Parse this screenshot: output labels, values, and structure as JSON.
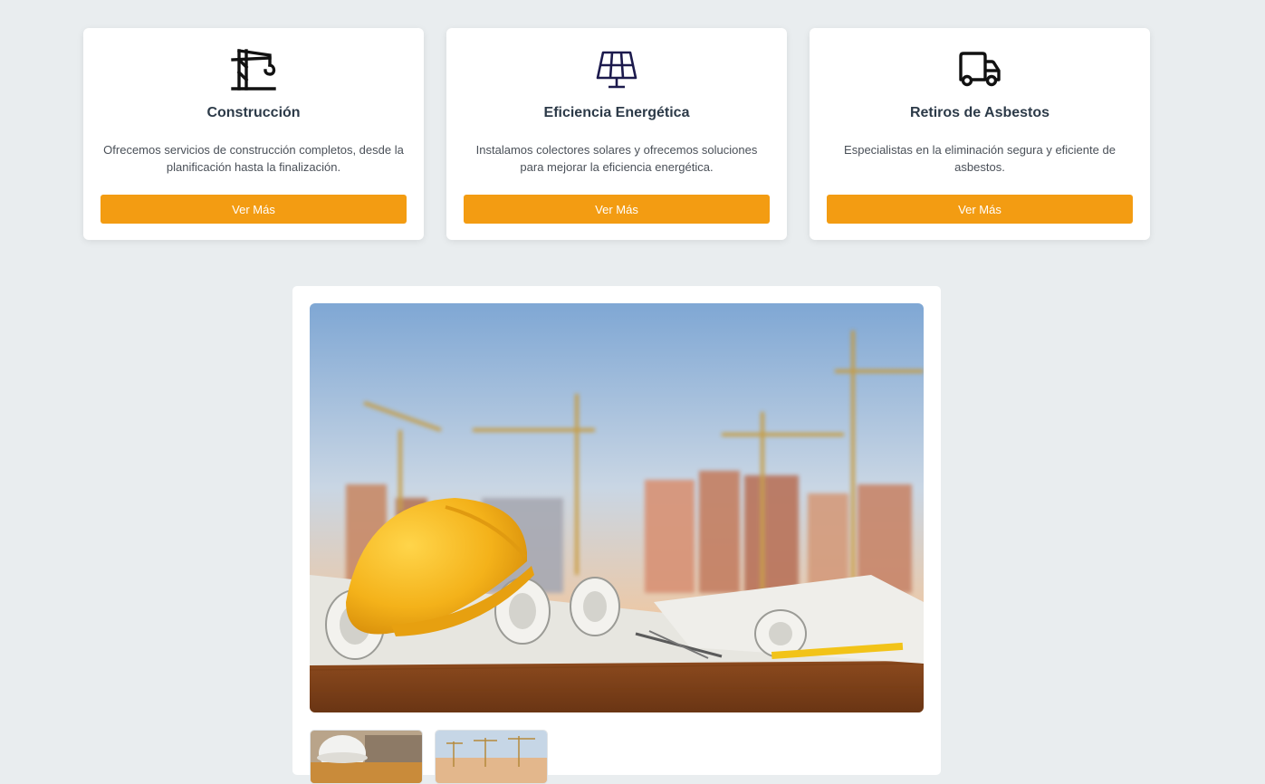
{
  "services": [
    {
      "icon": "crane-icon",
      "title": "Construcción",
      "description": "Ofrecemos servicios de construcción completos, desde la planificación hasta la finalización.",
      "button": "Ver Más"
    },
    {
      "icon": "solar-panel-icon",
      "title": "Eficiencia Energética",
      "description": "Instalamos colectores solares y ofrecemos soluciones para mejorar la eficiencia energética.",
      "button": "Ver Más"
    },
    {
      "icon": "truck-icon",
      "title": "Retiros de Asbestos",
      "description": "Especialistas en la eliminación segura y eficiente de asbestos.",
      "button": "Ver Más"
    }
  ],
  "colors": {
    "accent": "#f39c12",
    "background": "#e9edef",
    "icon_dark": "#111111",
    "icon_navy": "#1c1a4d"
  },
  "gallery": {
    "main_image": "construction-site-hardhat-blueprints-photo",
    "thumbnails": [
      "worker-hardhat-thumbnail",
      "cranes-skyline-thumbnail"
    ]
  }
}
